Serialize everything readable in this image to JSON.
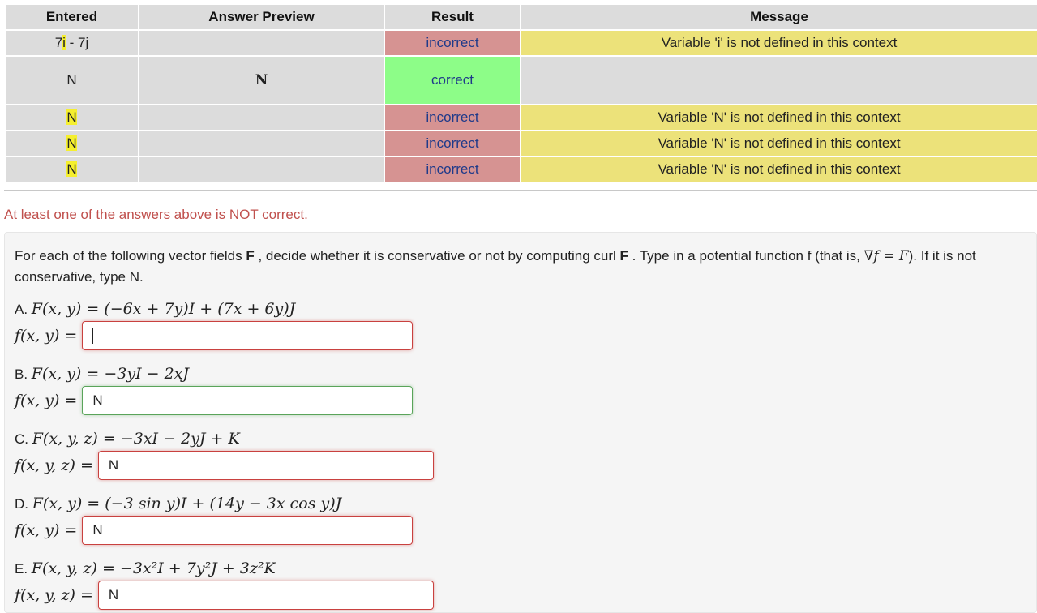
{
  "results_table": {
    "headers": [
      "Entered",
      "Answer Preview",
      "Result",
      "Message"
    ],
    "rows": [
      {
        "entered_pre": "7",
        "entered_hl": "i",
        "entered_post": " - 7j",
        "preview": "",
        "result": "incorrect",
        "message": "Variable 'i' is not defined in this context"
      },
      {
        "entered_pre": "N",
        "entered_hl": "",
        "entered_post": "",
        "preview": "N",
        "result": "correct",
        "message": ""
      },
      {
        "entered_pre": "",
        "entered_hl": "N",
        "entered_post": "",
        "preview": "",
        "result": "incorrect",
        "message": "Variable 'N' is not defined in this context"
      },
      {
        "entered_pre": "",
        "entered_hl": "N",
        "entered_post": "",
        "preview": "",
        "result": "incorrect",
        "message": "Variable 'N' is not defined in this context"
      },
      {
        "entered_pre": "",
        "entered_hl": "N",
        "entered_post": "",
        "preview": "",
        "result": "incorrect",
        "message": "Variable 'N' is not defined in this context"
      }
    ]
  },
  "warning": "At least one of the answers above is NOT correct.",
  "problem": {
    "intro_1": "For each of the following vector fields ",
    "intro_F1": "F",
    "intro_2": " , decide whether it is conservative or not by computing curl ",
    "intro_F2": "F",
    "intro_3": " . Type in a potential function f (that is, ",
    "intro_math": "∇f = F",
    "intro_4": "). If it is not conservative, type N.",
    "parts": [
      {
        "letter": "A. ",
        "field": "F(x, y) = (−6x + 7y)I + (7x + 6y)J",
        "fx": "f(x, y)",
        "value": "",
        "state": "bad",
        "cursor": true
      },
      {
        "letter": "B. ",
        "field": "F(x, y) = −3yI − 2xJ",
        "fx": "f(x, y)",
        "value": "N",
        "state": "good",
        "cursor": false
      },
      {
        "letter": "C. ",
        "field": "F(x, y, z) = −3xI − 2yJ + K",
        "fx": "f(x, y, z)",
        "value": "N",
        "state": "bad",
        "cursor": false
      },
      {
        "letter": "D. ",
        "field": "F(x, y) = (−3 sin y)I + (14y − 3x cos y)J",
        "fx": "f(x, y)",
        "value": "N",
        "state": "bad",
        "cursor": false
      },
      {
        "letter": "E. ",
        "field": "F(x, y, z) = −3x²I + 7y²J + 3z²K",
        "fx": "f(x, y, z)",
        "value": "N",
        "state": "bad",
        "cursor": false
      }
    ],
    "equals": "="
  }
}
